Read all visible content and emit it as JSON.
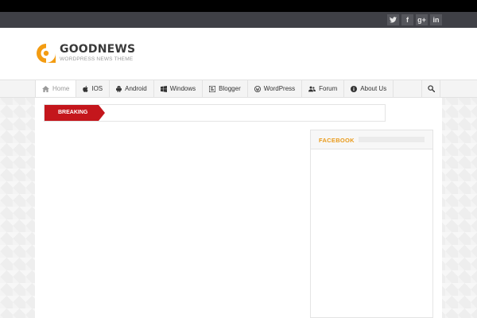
{
  "social": [
    {
      "name": "twitter",
      "glyph": "t"
    },
    {
      "name": "facebook",
      "glyph": "f"
    },
    {
      "name": "google-plus",
      "glyph": "g+"
    },
    {
      "name": "linkedin",
      "glyph": "in"
    }
  ],
  "logo": {
    "name": "GOODNEWS",
    "tagline": "WORDPRESS NEWS THEME",
    "color": "#f39c12"
  },
  "nav": {
    "items": [
      {
        "label": "Home",
        "icon": "home-icon"
      },
      {
        "label": "IOS",
        "icon": "apple-icon"
      },
      {
        "label": "Android",
        "icon": "android-icon"
      },
      {
        "label": "Windows",
        "icon": "windows-icon"
      },
      {
        "label": "Blogger",
        "icon": "blogger-icon"
      },
      {
        "label": "WordPress",
        "icon": "wordpress-icon"
      },
      {
        "label": "Forum",
        "icon": "users-icon"
      },
      {
        "label": "About Us",
        "icon": "info-icon"
      }
    ],
    "active_index": 0,
    "search_icon": "search-icon"
  },
  "breaking": {
    "label": "BREAKING",
    "color": "#c4161c"
  },
  "sidebar": {
    "widget_title": "FACEBOOK",
    "accent": "#e99a1a"
  }
}
